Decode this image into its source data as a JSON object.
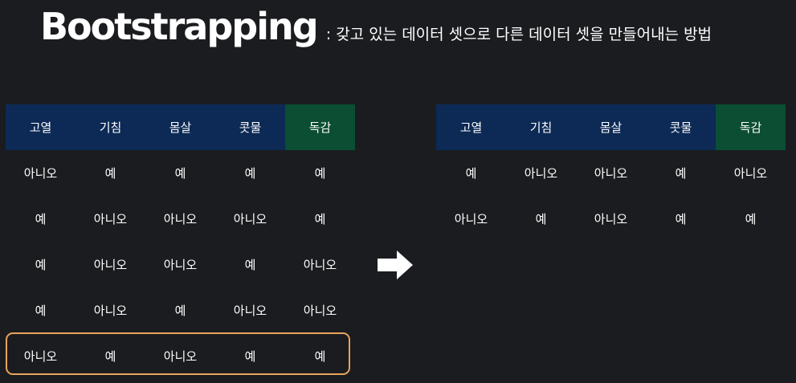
{
  "title": {
    "main": "Bootstrapping",
    "subtitle": ": 갖고 있는 데이터 셋으로 다른 데이터 셋을 만들어내는 방법"
  },
  "columns": [
    "고열",
    "기침",
    "몸살",
    "콧물",
    "독감"
  ],
  "original_table": {
    "rows": [
      [
        "아니오",
        "예",
        "예",
        "예",
        "예"
      ],
      [
        "예",
        "아니오",
        "아니오",
        "아니오",
        "예"
      ],
      [
        "예",
        "아니오",
        "아니오",
        "예",
        "아니오"
      ],
      [
        "예",
        "아니오",
        "예",
        "아니오",
        "아니오"
      ],
      [
        "아니오",
        "예",
        "아니오",
        "예",
        "예"
      ]
    ]
  },
  "bootstrapped_table": {
    "rows": [
      [
        "예",
        "아니오",
        "아니오",
        "예",
        "아니오"
      ],
      [
        "아니오",
        "예",
        "아니오",
        "예",
        "예"
      ]
    ]
  },
  "highlighted_row_index": 4,
  "colors": {
    "background": "#1b1c1f",
    "header_feature": "#0c2a55",
    "header_target": "#0b4e34",
    "highlight": "#e8a35c",
    "text": "#ffffff"
  },
  "icons": {
    "arrow": "arrow-right-icon"
  }
}
